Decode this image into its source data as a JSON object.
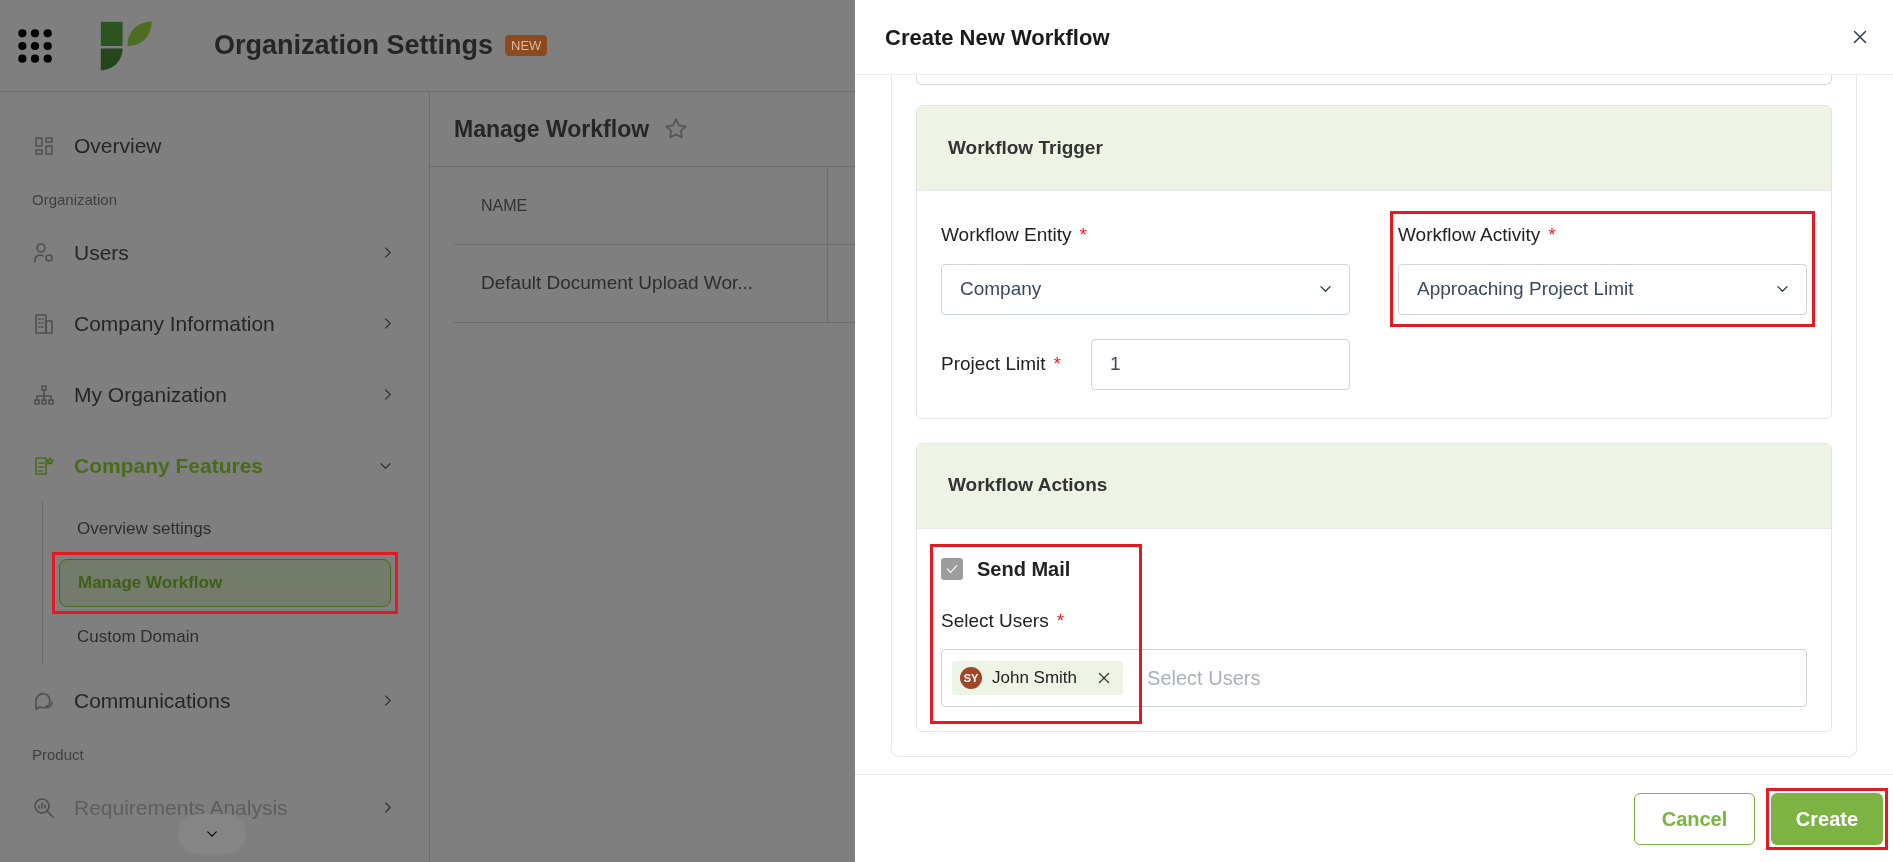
{
  "app": {
    "title": "Organization Settings",
    "badge": "NEW"
  },
  "sidebar": {
    "items": [
      {
        "kind": "link",
        "label": "Overview"
      },
      {
        "kind": "section",
        "label": "Organization"
      },
      {
        "kind": "group",
        "label": "Users",
        "expanded": false
      },
      {
        "kind": "group",
        "label": "Company Information",
        "expanded": false
      },
      {
        "kind": "group",
        "label": "My Organization",
        "expanded": false
      },
      {
        "kind": "group",
        "label": "Company Features",
        "expanded": true,
        "children": [
          {
            "label": "Overview settings",
            "selected": false,
            "highlighted": false
          },
          {
            "label": "Manage Workflow",
            "selected": true,
            "highlighted": true
          },
          {
            "label": "Custom Domain",
            "selected": false,
            "highlighted": false
          }
        ]
      },
      {
        "kind": "group",
        "label": "Communications",
        "expanded": false
      },
      {
        "kind": "section",
        "label": "Product"
      },
      {
        "kind": "group",
        "label": "Requirements Analysis",
        "expanded": false
      }
    ]
  },
  "page": {
    "title": "Manage Workflow",
    "table": {
      "columns": [
        "NAME"
      ],
      "rows": [
        [
          "Default Document Upload Wor..."
        ]
      ]
    }
  },
  "drawer": {
    "title": "Create New Workflow",
    "trigger": {
      "title": "Workflow Trigger",
      "fields": [
        {
          "kind": "select",
          "label": "Workflow Entity",
          "required_mark": "*",
          "value": "Company",
          "highlighted": false
        },
        {
          "kind": "select",
          "label": "Workflow Activity",
          "required_mark": "*",
          "value": "Approaching Project Limit",
          "highlighted": true
        },
        {
          "kind": "text",
          "label": "Project Limit",
          "required_mark": "*",
          "value": "1",
          "highlighted": false
        }
      ]
    },
    "actions": {
      "title": "Workflow Actions",
      "highlighted": true,
      "checkbox": {
        "label": "Send Mail",
        "checked": true
      },
      "users": {
        "label": "Select Users",
        "required_mark": "*",
        "placeholder": "Select Users",
        "chips": [
          {
            "initials": "SY",
            "name": "John Smith"
          }
        ]
      }
    },
    "buttons": [
      {
        "kind": "outline",
        "label": "Cancel",
        "highlighted": false
      },
      {
        "kind": "primary",
        "label": "Create",
        "highlighted": true
      }
    ]
  }
}
